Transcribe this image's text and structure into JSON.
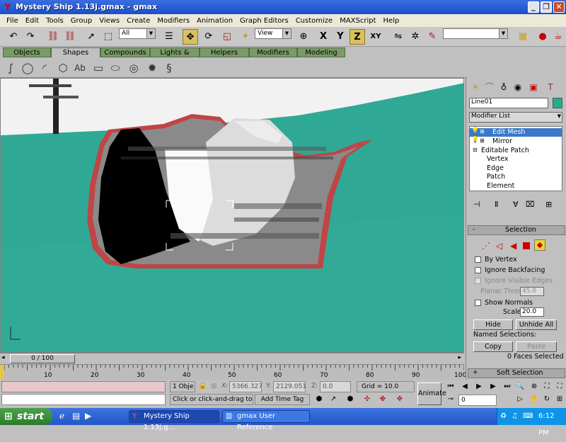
{
  "window": {
    "title": "Mystery Ship 1.13j.gmax - gmax",
    "app_icon": "gmax-logo-icon"
  },
  "menu": [
    "File",
    "Edit",
    "Tools",
    "Group",
    "Views",
    "Create",
    "Modifiers",
    "Animation",
    "Graph Editors",
    "Customize",
    "MAXScript",
    "Help"
  ],
  "toolbar": {
    "filter_value": "All",
    "coord_value": "View",
    "axis_x": "X",
    "axis_y": "Y",
    "axis_z": "Z",
    "axis_xy": "XY"
  },
  "tabs": [
    "Objects",
    "Shapes",
    "Compounds",
    "Lights & Cameras",
    "Helpers",
    "Modifiers",
    "Modeling"
  ],
  "command_panel": {
    "object_name": "Line01",
    "object_color": "#20b08a",
    "modifier_list": "Modifier List",
    "stack": [
      {
        "label": "Edit Mesh"
      },
      {
        "label": "Mirror"
      },
      {
        "label": "Editable Patch"
      },
      {
        "label": "Vertex"
      },
      {
        "label": "Edge"
      },
      {
        "label": "Patch"
      },
      {
        "label": "Element"
      }
    ],
    "selection_title": "Selection",
    "by_vertex": "By Vertex",
    "ignore_backfacing": "Ignore Backfacing",
    "ignore_visible_edges": "Ignore Visible Edges",
    "planar_thresh_label": "Planar Thresh:",
    "planar_thresh_value": "45.0",
    "show_normals": "Show Normals",
    "scale_label": "Scale:",
    "scale_value": "20.0",
    "hide": "Hide",
    "unhide_all": "Unhide All",
    "named_selections": "Named Selections:",
    "copy": "Copy",
    "paste": "Paste",
    "faces_selected": "0 Faces Selected",
    "soft_selection": "Soft Selection"
  },
  "viewport": {
    "scroll_label": "0 / 100"
  },
  "ruler": {
    "ticks": [
      "10",
      "20",
      "30",
      "40",
      "50",
      "60",
      "70",
      "80",
      "90",
      "100"
    ]
  },
  "status": {
    "selected": "1 Obje",
    "x_label": "X:",
    "x_value": "5366.327",
    "y_label": "Y:",
    "y_value": "2129.051",
    "z_label": "Z:",
    "z_value": "0.0",
    "grid": "Grid = 10.0",
    "prompt": "Click or click-and-drag to selec",
    "add_time_tag": "Add Time Tag",
    "animate": "Animate",
    "frame": "0"
  },
  "taskbar": {
    "start": "start",
    "tasks": [
      "Mystery Ship 1.13j.g...",
      "gmax User Reference"
    ],
    "clock": "6:12 PM"
  }
}
